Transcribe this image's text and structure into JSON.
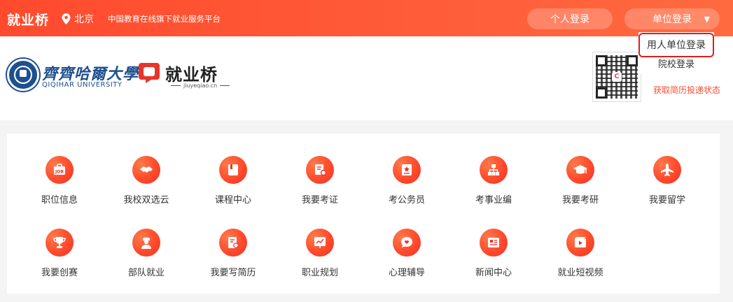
{
  "topbar": {
    "brand": "就业桥",
    "location": "北京",
    "slogan": "中国教育在线旗下就业服务平台",
    "personal_login": "个人登录",
    "unit_login": "单位登录",
    "unit_caret": "▼"
  },
  "dropdown": {
    "items": [
      "用人单位登录",
      "院校登录"
    ]
  },
  "header": {
    "univ_name": "齊齊哈爾大學",
    "univ_en": "QIQIHAR UNIVERSITY",
    "platform_name": "就业桥",
    "platform_url": "jiuyeqiao.cn",
    "qr_hint": "获取简历投递状态"
  },
  "services": [
    {
      "label": "职位信息",
      "icon": "job-icon"
    },
    {
      "label": "我校双选云",
      "icon": "handshake-icon"
    },
    {
      "label": "课程中心",
      "icon": "book-icon"
    },
    {
      "label": "我要考证",
      "icon": "certificate-icon"
    },
    {
      "label": "考公务员",
      "icon": "civil-service-icon"
    },
    {
      "label": "考事业编",
      "icon": "org-chart-icon"
    },
    {
      "label": "我要考研",
      "icon": "graduation-cap-icon"
    },
    {
      "label": "我要留学",
      "icon": "plane-icon"
    },
    {
      "label": "我要创赛",
      "icon": "trophy-icon"
    },
    {
      "label": "部队就业",
      "icon": "soldier-icon"
    },
    {
      "label": "我要写简历",
      "icon": "resume-icon"
    },
    {
      "label": "职业规划",
      "icon": "chart-board-icon"
    },
    {
      "label": "心理辅导",
      "icon": "chat-heart-icon"
    },
    {
      "label": "新闻中心",
      "icon": "news-icon"
    },
    {
      "label": "就业短视频",
      "icon": "video-icon"
    }
  ],
  "colors": {
    "brand": "#ff4a2e",
    "highlight_border": "#d81f1f",
    "university_blue": "#1e4f8f"
  }
}
